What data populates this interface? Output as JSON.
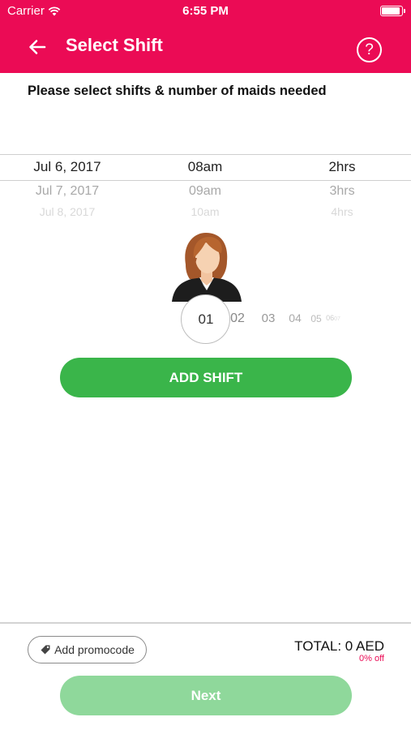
{
  "status_bar": {
    "carrier": "Carrier",
    "time": "6:55 PM"
  },
  "nav": {
    "title": "Select Shift",
    "help_glyph": "?",
    "back_icon": "arrow-left-icon",
    "color": "#eb0b55"
  },
  "instruction": "Please select shifts & number of maids needed",
  "picker": {
    "rows": [
      {
        "date": "Jul 6, 2017",
        "time": "08am",
        "duration": "2hrs",
        "state": "selected"
      },
      {
        "date": "Jul 7, 2017",
        "time": "09am",
        "duration": "3hrs",
        "state": "next"
      },
      {
        "date": "Jul 8, 2017",
        "time": "10am",
        "duration": "4hrs",
        "state": "faded"
      }
    ]
  },
  "maid_count": {
    "selected": "01",
    "options": [
      "01",
      "02",
      "03",
      "04",
      "05",
      "06",
      "07"
    ]
  },
  "add_shift_label": "ADD SHIFT",
  "footer": {
    "promo_label": "Add promocode",
    "total_label": "TOTAL: 0 AED",
    "discount_label": "0% off",
    "next_label": "Next"
  },
  "colors": {
    "brand": "#eb0b55",
    "green": "#3ab54a",
    "green_disabled": "#8fd89b"
  }
}
